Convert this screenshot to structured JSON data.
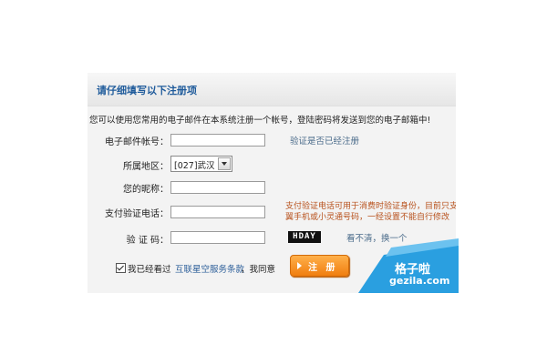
{
  "header": {
    "title": "请仔细填写以下注册项"
  },
  "intro": "您可以使用您常用的电子邮件在本系统注册一个帐号，登陆密码将发送到您的电子邮箱中!",
  "form": {
    "email_label": "电子邮件帐号：",
    "email_value": "",
    "verify_link": "验证是否已经注册",
    "region_label": "所属地区：",
    "region_selected": "[027]武汉",
    "nickname_label": "您的昵称：",
    "nickname_value": "",
    "phone_label": "支付验证电话：",
    "phone_value": "",
    "phone_hint_line1": "支付验证电话可用于消费时验证身份，目前只支",
    "phone_hint_line2": "翼手机或小灵通号码，一经设置不能自行修改",
    "captcha_label": "验 证 码：",
    "captcha_value": "",
    "captcha_text": "HDAY",
    "refresh_link": "看不清，换一个"
  },
  "agreement": {
    "checked": true,
    "pre_text": "我已经看过",
    "terms_link": "互联星空服务条款",
    "post_text": "，我同意"
  },
  "register_button": {
    "label": "注 册"
  },
  "watermark": {
    "cn": "格子啦",
    "en": "gezila.com"
  },
  "colors": {
    "title_blue": "#1f5b9b",
    "link_gray_blue": "#4a6b8a",
    "hint_orange": "#b8521d",
    "button_orange": "#f07e10",
    "watermark_blue": "#2a9fe0"
  }
}
